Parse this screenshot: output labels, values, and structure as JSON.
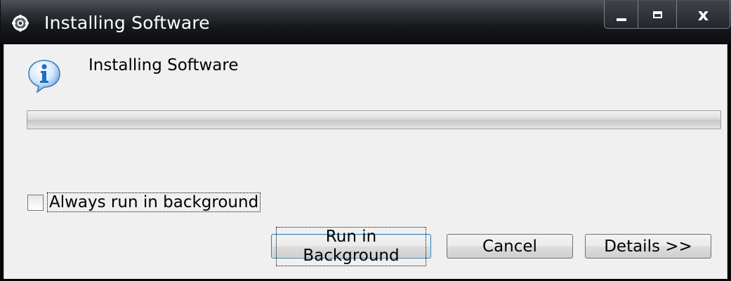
{
  "window": {
    "title": "Installing Software",
    "title_icon": "eclipse-gear-icon"
  },
  "controls": {
    "minimize_icon": "minimize-icon",
    "maximize_icon": "maximize-icon",
    "close_icon": "close-icon",
    "close_glyph": "x"
  },
  "dialog": {
    "icon": "info-icon",
    "message": "Installing Software",
    "progress": 0,
    "checkbox_label": "Always run in background",
    "checkbox_checked": false
  },
  "buttons": {
    "run_in_background": "Run in Background",
    "cancel": "Cancel",
    "details": "Details >>"
  },
  "colors": {
    "titlebar": "#17191d",
    "dialog_bg": "#f0f0f0",
    "info_blue": "#1e6fc2"
  }
}
